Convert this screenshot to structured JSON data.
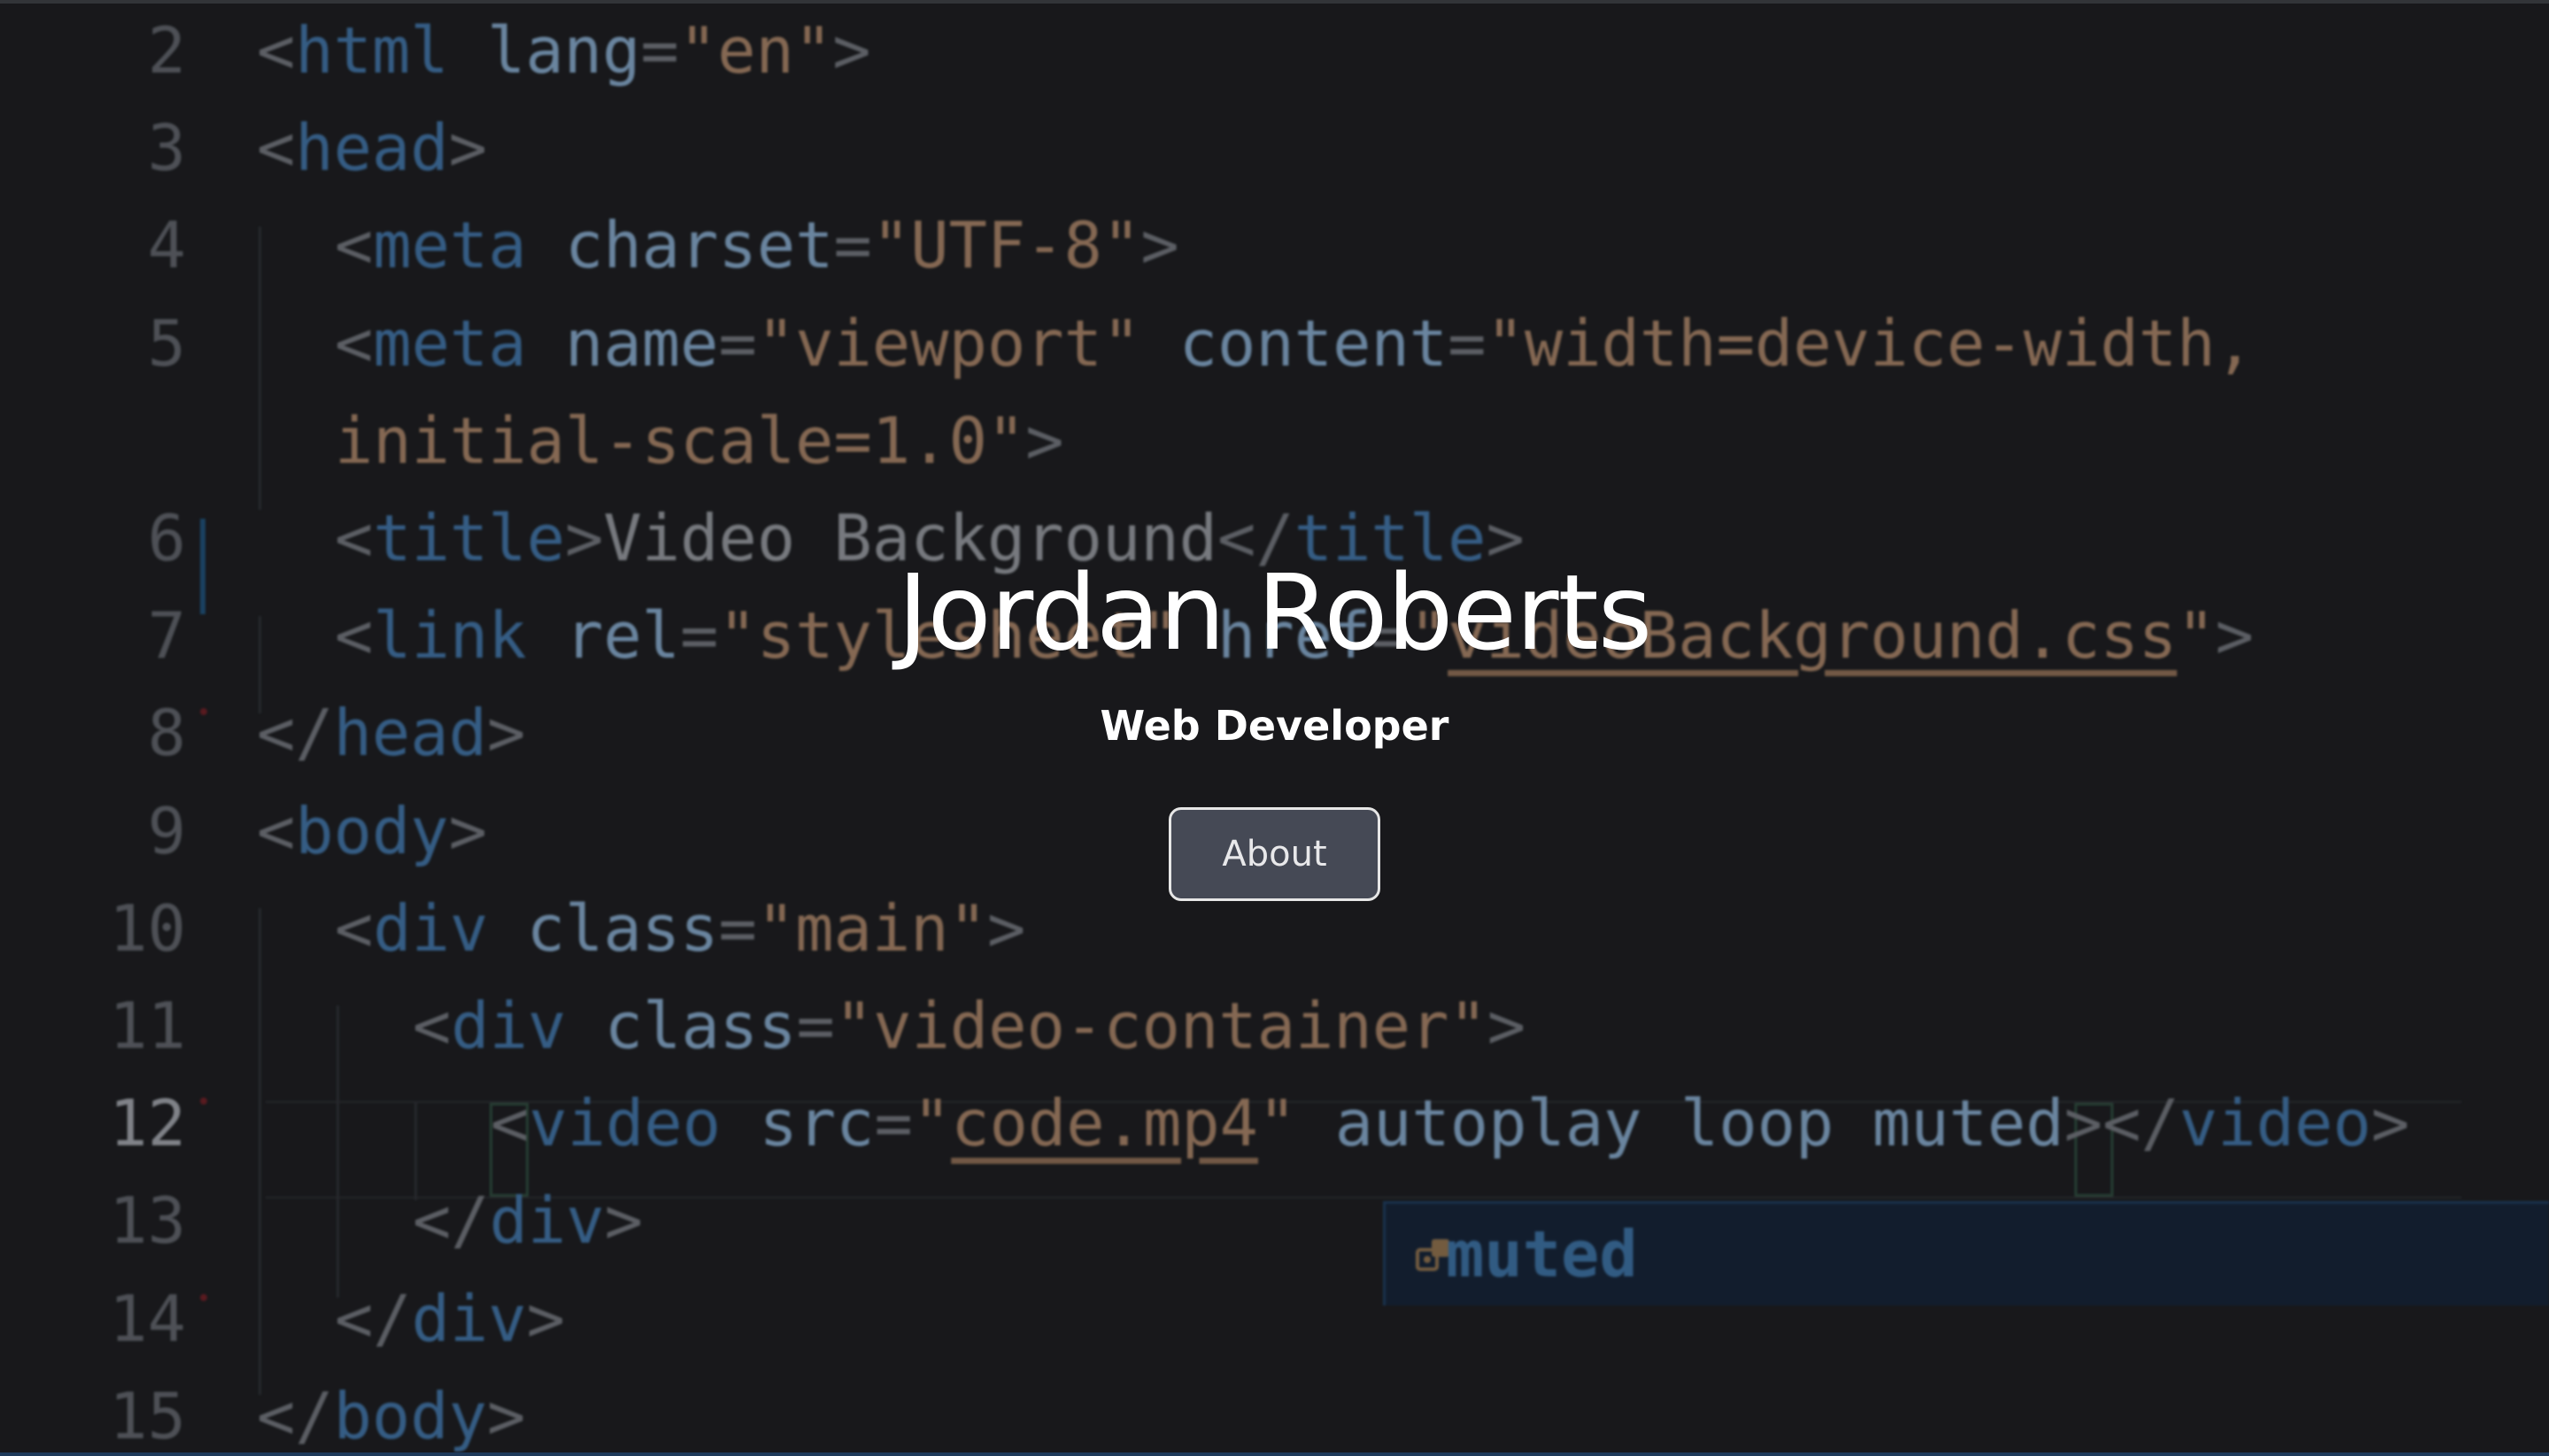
{
  "hero": {
    "name": "Jordan Roberts",
    "role": "Web Developer",
    "about_button": "About"
  },
  "editor": {
    "lines": [
      {
        "num": "2",
        "parts": [
          [
            "t",
            "<"
          ],
          [
            "k",
            "html"
          ],
          [
            "t",
            " "
          ],
          [
            "a",
            "lang"
          ],
          [
            "t",
            "="
          ],
          [
            "s",
            "\"en\""
          ],
          [
            "t",
            ">"
          ]
        ]
      },
      {
        "num": "3",
        "parts": [
          [
            "t",
            "<"
          ],
          [
            "k",
            "head"
          ],
          [
            "t",
            ">"
          ]
        ]
      },
      {
        "num": "4",
        "parts": [
          [
            "t",
            "<"
          ],
          [
            "k",
            "meta"
          ],
          [
            "t",
            " "
          ],
          [
            "a",
            "charset"
          ],
          [
            "t",
            "="
          ],
          [
            "s",
            "\"UTF-8\""
          ],
          [
            "t",
            ">"
          ]
        ]
      },
      {
        "num": "5",
        "parts": [
          [
            "t",
            "<"
          ],
          [
            "k",
            "meta"
          ],
          [
            "t",
            " "
          ],
          [
            "a",
            "name"
          ],
          [
            "t",
            "="
          ],
          [
            "s",
            "\"viewport\""
          ],
          [
            "t",
            " "
          ],
          [
            "a",
            "content"
          ],
          [
            "t",
            "="
          ],
          [
            "s",
            "\"width=device-width,"
          ]
        ]
      },
      {
        "num": "",
        "parts": [
          [
            "s",
            "initial-scale=1.0\""
          ],
          [
            "t",
            ">"
          ]
        ]
      },
      {
        "num": "6",
        "parts": [
          [
            "t",
            "<"
          ],
          [
            "k",
            "title"
          ],
          [
            "t",
            ">"
          ],
          [
            "tx",
            "Video Background"
          ],
          [
            "t",
            "</"
          ],
          [
            "k",
            "title"
          ],
          [
            "t",
            ">"
          ]
        ]
      },
      {
        "num": "7",
        "parts": [
          [
            "t",
            "<"
          ],
          [
            "k",
            "link"
          ],
          [
            "t",
            " "
          ],
          [
            "a",
            "rel"
          ],
          [
            "t",
            "="
          ],
          [
            "s",
            "\"stylesheet\""
          ],
          [
            "t",
            " "
          ],
          [
            "a",
            "href"
          ],
          [
            "t",
            "="
          ],
          [
            "s",
            "\""
          ],
          [
            "su",
            "videoBackground.css"
          ],
          [
            "s",
            "\""
          ],
          [
            "t",
            ">"
          ]
        ]
      },
      {
        "num": "8",
        "parts": [
          [
            "t",
            "</"
          ],
          [
            "k",
            "head"
          ],
          [
            "t",
            ">"
          ]
        ]
      },
      {
        "num": "9",
        "parts": [
          [
            "t",
            "<"
          ],
          [
            "k",
            "body"
          ],
          [
            "t",
            ">"
          ]
        ]
      },
      {
        "num": "10",
        "parts": [
          [
            "t",
            "<"
          ],
          [
            "k",
            "div"
          ],
          [
            "t",
            " "
          ],
          [
            "a",
            "class"
          ],
          [
            "t",
            "="
          ],
          [
            "s",
            "\"main\""
          ],
          [
            "t",
            ">"
          ]
        ]
      },
      {
        "num": "11",
        "parts": [
          [
            "t",
            "<"
          ],
          [
            "k",
            "div"
          ],
          [
            "t",
            " "
          ],
          [
            "a",
            "class"
          ],
          [
            "t",
            "="
          ],
          [
            "s",
            "\"video-container\""
          ],
          [
            "t",
            ">"
          ]
        ]
      },
      {
        "num": "12",
        "parts": [
          [
            "t",
            "<"
          ],
          [
            "k",
            "video"
          ],
          [
            "t",
            " "
          ],
          [
            "a",
            "src"
          ],
          [
            "t",
            "="
          ],
          [
            "s",
            "\""
          ],
          [
            "su",
            "code.mp4"
          ],
          [
            "s",
            "\""
          ],
          [
            "t",
            " "
          ],
          [
            "a",
            "autoplay"
          ],
          [
            "t",
            " "
          ],
          [
            "a",
            "loop"
          ],
          [
            "t",
            " "
          ],
          [
            "a",
            "muted"
          ],
          [
            "t",
            "></"
          ],
          [
            "k",
            "video"
          ],
          [
            "t",
            ">"
          ]
        ]
      },
      {
        "num": "13",
        "parts": [
          [
            "t",
            "</"
          ],
          [
            "k",
            "div"
          ],
          [
            "t",
            ">"
          ]
        ]
      },
      {
        "num": "14",
        "parts": [
          [
            "t",
            "</"
          ],
          [
            "k",
            "div"
          ],
          [
            "t",
            ">"
          ]
        ]
      },
      {
        "num": "15",
        "parts": [
          [
            "t",
            "</"
          ],
          [
            "k",
            "body"
          ],
          [
            "t",
            ">"
          ]
        ]
      }
    ],
    "active_line": "12",
    "suggestion": {
      "icon": "attribute-icon",
      "label": "muted"
    }
  },
  "colors": {
    "background": "#1b1c1e",
    "tag": "#3f6f9e",
    "attribute": "#7fa0bf",
    "string": "#a07d62",
    "button_bg": "#454955",
    "button_border": "#e6e6e6",
    "hero_text": "#ffffff"
  }
}
